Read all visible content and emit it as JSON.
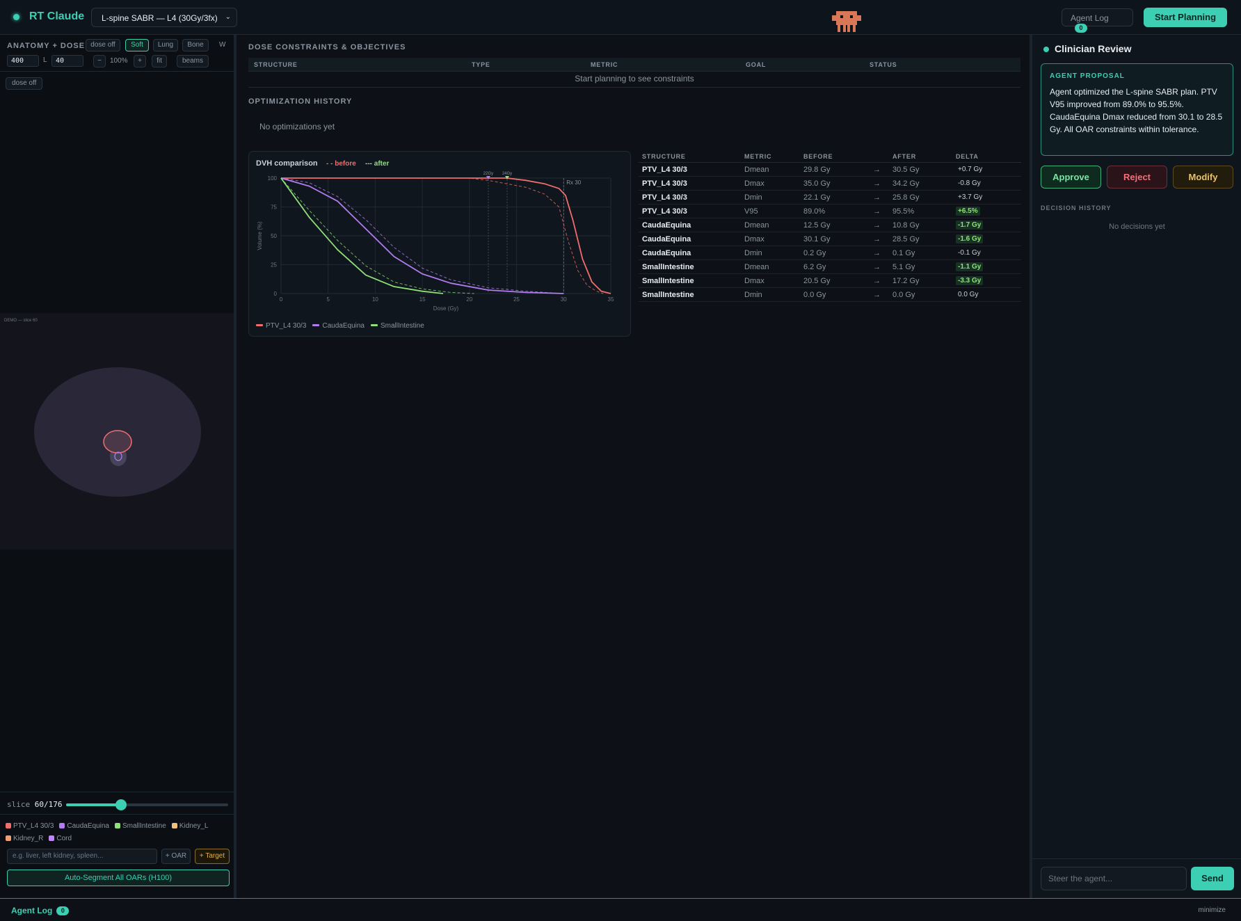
{
  "header": {
    "brand": "RT Claude",
    "case_select": "L-spine SABR — L4 (30Gy/3fx)",
    "agent_log_label": "Agent Log",
    "agent_log_count": "0",
    "start_button": "Start Planning"
  },
  "left": {
    "title": "ANATOMY + DOSE",
    "dose_toggle": "dose off",
    "presets": [
      "Soft",
      "Lung",
      "Bone"
    ],
    "w_label": "W",
    "w_value": "400",
    "l_label": "L",
    "l_value": "40",
    "zoom_minus": "−",
    "zoom_pct": "100%",
    "zoom_plus": "+",
    "fit": "fit",
    "beams": "beams",
    "dose_chip": "dose off",
    "ct_label": "DEMO — slice 60",
    "slice_label": "slice",
    "slice_value": "60/176",
    "slice_current": 60,
    "slice_total": 176,
    "legend": [
      {
        "name": "PTV_L4 30/3",
        "color": "#f26d6d"
      },
      {
        "name": "CaudaEquina",
        "color": "#b27cf0"
      },
      {
        "name": "SmallIntestine",
        "color": "#8fe07a"
      },
      {
        "name": "Kidney_L",
        "color": "#f0c27a"
      },
      {
        "name": "Kidney_R",
        "color": "#f0a070"
      },
      {
        "name": "Cord",
        "color": "#c084fc"
      }
    ],
    "oar_placeholder": "e.g. liver, left kidney, spleen...",
    "oar_button": "+ OAR",
    "target_button": "+ Target",
    "autoseg_button": "Auto-Segment All OARs (H100)"
  },
  "center": {
    "constraints_title": "DOSE CONSTRAINTS & OBJECTIVES",
    "constraints_headers": [
      "STRUCTURE",
      "TYPE",
      "METRIC",
      "GOAL",
      "STATUS"
    ],
    "constraints_empty": "Start planning to see constraints",
    "opt_title": "OPTIMIZATION HISTORY",
    "opt_empty": "No optimizations yet",
    "dvh_title": "DVH comparison",
    "dvh_before": "- - before",
    "dvh_after": "--- after",
    "cmp_headers": [
      "STRUCTURE",
      "METRIC",
      "BEFORE",
      "AFTER",
      "DELTA"
    ],
    "cmp_rows": [
      {
        "structure": "PTV_L4 30/3",
        "metric": "Dmean",
        "before": "29.8 Gy",
        "arrow": "→",
        "after": "30.5 Gy",
        "delta": "+0.7 Gy",
        "highlight": false
      },
      {
        "structure": "PTV_L4 30/3",
        "metric": "Dmax",
        "before": "35.0 Gy",
        "arrow": "→",
        "after": "34.2 Gy",
        "delta": "-0.8 Gy",
        "highlight": false
      },
      {
        "structure": "PTV_L4 30/3",
        "metric": "Dmin",
        "before": "22.1 Gy",
        "arrow": "→",
        "after": "25.8 Gy",
        "delta": "+3.7 Gy",
        "highlight": false
      },
      {
        "structure": "PTV_L4 30/3",
        "metric": "V95",
        "before": "89.0%",
        "arrow": "→",
        "after": "95.5%",
        "delta": "+6.5%",
        "highlight": true
      },
      {
        "structure": "CaudaEquina",
        "metric": "Dmean",
        "before": "12.5 Gy",
        "arrow": "→",
        "after": "10.8 Gy",
        "delta": "-1.7 Gy",
        "highlight": true
      },
      {
        "structure": "CaudaEquina",
        "metric": "Dmax",
        "before": "30.1 Gy",
        "arrow": "→",
        "after": "28.5 Gy",
        "delta": "-1.6 Gy",
        "highlight": true
      },
      {
        "structure": "CaudaEquina",
        "metric": "Dmin",
        "before": "0.2 Gy",
        "arrow": "→",
        "after": "0.1 Gy",
        "delta": "-0.1 Gy",
        "highlight": false
      },
      {
        "structure": "SmallIntestine",
        "metric": "Dmean",
        "before": "6.2 Gy",
        "arrow": "→",
        "after": "5.1 Gy",
        "delta": "-1.1 Gy",
        "highlight": true
      },
      {
        "structure": "SmallIntestine",
        "metric": "Dmax",
        "before": "20.5 Gy",
        "arrow": "→",
        "after": "17.2 Gy",
        "delta": "-3.3 Gy",
        "highlight": true
      },
      {
        "structure": "SmallIntestine",
        "metric": "Dmin",
        "before": "0.0 Gy",
        "arrow": "→",
        "after": "0.0 Gy",
        "delta": "0.0 Gy",
        "highlight": false
      }
    ]
  },
  "right": {
    "title": "Clinician Review",
    "proposal_label": "AGENT PROPOSAL",
    "proposal_text": "Agent optimized the L-spine SABR plan. PTV V95 improved from 89.0% to 95.5%. CaudaEquina Dmax reduced from 30.1 to 28.5 Gy. All OAR constraints within tolerance.",
    "approve": "Approve",
    "reject": "Reject",
    "modify": "Modify",
    "decision_title": "DECISION HISTORY",
    "decision_empty": "No decisions yet",
    "steer_placeholder": "Steer the agent...",
    "send": "Send"
  },
  "bottom": {
    "title": "Agent Log",
    "count": "0",
    "minimize": "minimize"
  },
  "colors": {
    "accent": "#3ccfb4",
    "ptv": "#f26d6d",
    "cauda": "#b27cf0",
    "intestine": "#8fe07a"
  },
  "chart_data": {
    "type": "line",
    "title": "DVH comparison",
    "xlabel": "Dose (Gy)",
    "ylabel": "Volume (%)",
    "xlim": [
      0,
      35
    ],
    "ylim": [
      0,
      100
    ],
    "xticks": [
      0,
      5,
      10,
      15,
      20,
      25,
      30,
      35
    ],
    "yticks": [
      0,
      25,
      50,
      75,
      100
    ],
    "grid": true,
    "legend_position": "bottom",
    "markers": [
      {
        "label": "22Gy",
        "x": 22
      },
      {
        "label": "24Gy",
        "x": 24
      }
    ],
    "rx_line": {
      "label": "Rx 30",
      "x": 30
    },
    "series": [
      {
        "name": "PTV_L4 30/3",
        "phase": "before",
        "color": "#f26d6d",
        "x": [
          0,
          20,
          22,
          24,
          26,
          28,
          29.5,
          30.5,
          31.5,
          32.5,
          33.5,
          34.2
        ],
        "y": [
          100,
          100,
          98,
          95,
          92,
          86,
          75,
          45,
          20,
          7,
          2,
          0
        ]
      },
      {
        "name": "PTV_L4 30/3",
        "phase": "after",
        "color": "#f26d6d",
        "x": [
          0,
          22,
          24,
          26,
          28,
          29.5,
          30.2,
          31,
          32,
          33,
          34,
          35
        ],
        "y": [
          100,
          100,
          100,
          98,
          95,
          91,
          85,
          63,
          30,
          10,
          2,
          0
        ]
      },
      {
        "name": "CaudaEquina",
        "phase": "before",
        "color": "#b27cf0",
        "x": [
          0,
          3,
          6,
          9,
          12,
          15,
          18,
          22,
          26,
          30
        ],
        "y": [
          100,
          96,
          84,
          64,
          40,
          22,
          12,
          5,
          2,
          0
        ]
      },
      {
        "name": "CaudaEquina",
        "phase": "after",
        "color": "#b27cf0",
        "x": [
          0,
          3,
          6,
          9,
          12,
          15,
          18,
          22,
          26,
          30
        ],
        "y": [
          100,
          93,
          80,
          56,
          32,
          17,
          9,
          3,
          1,
          0
        ]
      },
      {
        "name": "SmallIntestine",
        "phase": "before",
        "color": "#8fe07a",
        "x": [
          0,
          3,
          6,
          9,
          12,
          15,
          18,
          20.5
        ],
        "y": [
          100,
          72,
          46,
          24,
          10,
          4,
          1,
          0
        ]
      },
      {
        "name": "SmallIntestine",
        "phase": "after",
        "color": "#8fe07a",
        "x": [
          0,
          3,
          6,
          9,
          12,
          15,
          17.2
        ],
        "y": [
          100,
          66,
          38,
          16,
          6,
          2,
          0
        ]
      }
    ]
  }
}
